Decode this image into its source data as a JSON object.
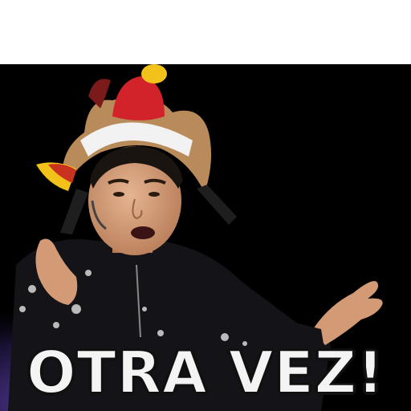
{
  "caption": {
    "text": "OTRA VEZ!"
  },
  "colors": {
    "background_top": "#ffffff",
    "backdrop": "#000000",
    "stage_glow": "#5a3fa8",
    "stage_warm": "#c8643a",
    "skin": "#d9a27c",
    "hair": "#1a1410",
    "hat_fur": "#b98a5a",
    "hat_red": "#d2232a",
    "hat_yellow": "#f2c21b",
    "jacket": "#141418",
    "caption_fill": "#f4f4f4",
    "caption_outline": "#111111"
  }
}
